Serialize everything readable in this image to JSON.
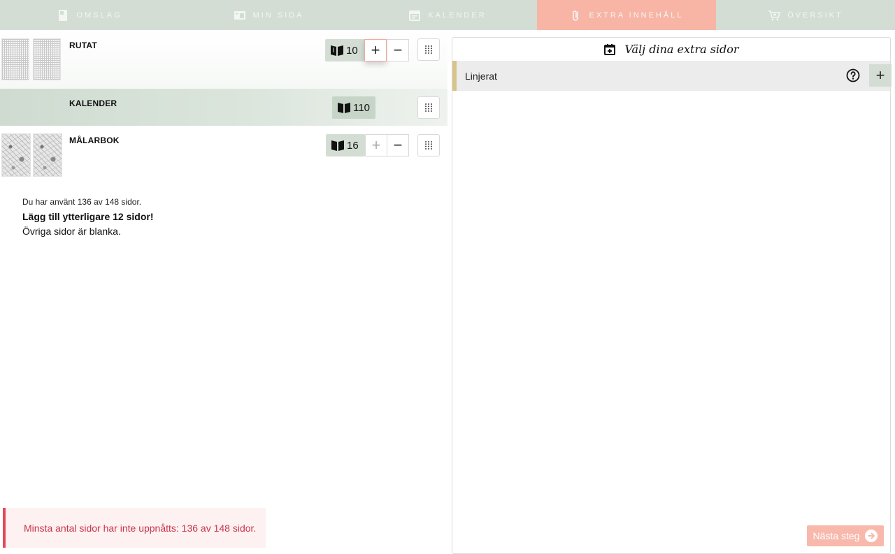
{
  "nav": {
    "tabs": [
      {
        "label": "OMSLAG",
        "icon": "cover-icon"
      },
      {
        "label": "MIN SIDA",
        "icon": "page-icon"
      },
      {
        "label": "KALENDER",
        "icon": "calendar-icon"
      },
      {
        "label": "EXTRA INNEHÅLL",
        "icon": "paperclip-icon",
        "active": true
      },
      {
        "label": "ÖVERSIKT",
        "icon": "cart-icon"
      }
    ]
  },
  "sections": [
    {
      "title": "RUTAT",
      "pages": "10"
    },
    {
      "title": "KALENDER",
      "pages": "110"
    },
    {
      "title": "MÅLARBOK",
      "pages": "16"
    }
  ],
  "controls": {
    "plus": "+",
    "minus": "−"
  },
  "info": {
    "used": "Du har använt 136 av 148 sidor.",
    "add_more": "Lägg till ytterligare 12 sidor!",
    "blank": "Övriga sidor är blanka."
  },
  "warning": "Minsta antal sidor har inte uppnåtts: 136 av 148 sidor.",
  "panel": {
    "title": "Välj dina extra sidor",
    "items": [
      {
        "label": "Linjerat"
      }
    ]
  },
  "next_button": "Nästa steg",
  "colors": {
    "nav_bg": "#d3ddd4",
    "active_tab": "#f8b5a6",
    "warning": "#e5475c",
    "accent_gold": "#d7c48d"
  }
}
